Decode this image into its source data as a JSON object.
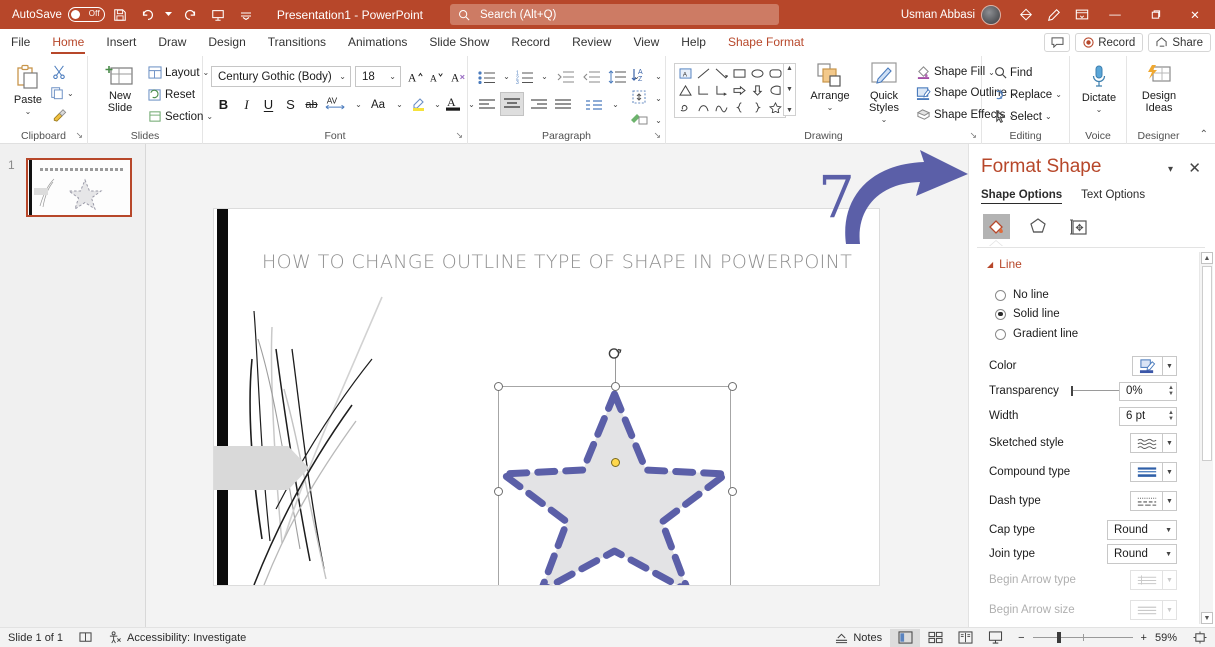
{
  "titlebar": {
    "autosave_label": "AutoSave",
    "autosave_state": "Off",
    "save_icon": "save-icon",
    "undo_icon": "undo-icon",
    "redo_icon": "redo-icon",
    "present_icon": "start-presentation-icon",
    "customize_icon": "customize-quick-access-icon",
    "document_title": "Presentation1  -  PowerPoint",
    "user_name": "Usman Abbasi",
    "search_placeholder": "Search (Alt+Q)",
    "diamond_icon": "microsoft-365-diamond-icon",
    "pen_icon": "pen-icon",
    "ribbon_display_icon": "ribbon-display-options-icon",
    "minimize_label": "—",
    "restore_label": "❐",
    "close_label": "✕"
  },
  "tabs": [
    {
      "label": "File",
      "active": false
    },
    {
      "label": "Home",
      "active": true
    },
    {
      "label": "Insert",
      "active": false
    },
    {
      "label": "Draw",
      "active": false
    },
    {
      "label": "Design",
      "active": false
    },
    {
      "label": "Transitions",
      "active": false
    },
    {
      "label": "Animations",
      "active": false
    },
    {
      "label": "Slide Show",
      "active": false
    },
    {
      "label": "Record",
      "active": false
    },
    {
      "label": "Review",
      "active": false
    },
    {
      "label": "View",
      "active": false
    },
    {
      "label": "Help",
      "active": false
    },
    {
      "label": "Shape Format",
      "active": false,
      "contextual": true
    }
  ],
  "tabbar_right": {
    "comments_icon": "comments-icon",
    "record_label": "Record",
    "share_label": "Share"
  },
  "ribbon": {
    "clipboard": {
      "group_label": "Clipboard",
      "paste_label": "Paste",
      "cut_icon": "scissors-icon",
      "copy_icon": "copy-icon",
      "format_painter_icon": "format-painter-icon",
      "dialog_launcher": "↘"
    },
    "slides": {
      "group_label": "Slides",
      "new_slide_label": "New\nSlide",
      "layout_label": "Layout",
      "reset_label": "Reset",
      "section_label": "Section"
    },
    "font": {
      "group_label": "Font",
      "font_family": "Century Gothic (Body)",
      "font_size": "18",
      "grow_font_icon": "grow-font-icon",
      "shrink_font_icon": "shrink-font-icon",
      "clear_formatting_icon": "clear-formatting-icon",
      "bold": "B",
      "italic": "I",
      "underline": "U",
      "shadow": "S",
      "strikethrough": "ab",
      "character_spacing": "AV",
      "change_case": "Aa",
      "highlight_icon": "text-highlight-icon",
      "font_color_icon": "font-color-icon",
      "dialog_launcher": "↘"
    },
    "paragraph": {
      "group_label": "Paragraph",
      "bullets_icon": "bullets-icon",
      "numbering_icon": "numbering-icon",
      "decrease_indent_icon": "decrease-indent-icon",
      "increase_indent_icon": "increase-indent-icon",
      "line_spacing_icon": "line-spacing-icon",
      "text_direction_icon": "text-direction-icon",
      "align_text_icon": "align-text-icon",
      "smartart_icon": "convert-to-smartart-icon",
      "align_left_icon": "align-left-icon",
      "align_center_icon": "align-center-icon",
      "align_right_icon": "align-right-icon",
      "justify_icon": "justify-icon",
      "columns_icon": "columns-icon",
      "dialog_launcher": "↘"
    },
    "drawing": {
      "group_label": "Drawing",
      "arrange_label": "Arrange",
      "quick_styles_label": "Quick\nStyles",
      "shape_fill_label": "Shape Fill",
      "shape_outline_label": "Shape Outline",
      "shape_effects_label": "Shape Effects",
      "dialog_launcher": "↘"
    },
    "editing": {
      "group_label": "Editing",
      "find_label": "Find",
      "replace_label": "Replace",
      "select_label": "Select"
    },
    "voice": {
      "group_label": "Voice",
      "dictate_label": "Dictate"
    },
    "designer": {
      "group_label": "Designer",
      "design_ideas_label": "Design\nIdeas"
    },
    "collapse_icon": "collapse-ribbon-icon"
  },
  "slides_panel": {
    "slide_number": "1"
  },
  "slide": {
    "title": "HOW TO CHANGE OUTLINE  TYPE OF SHAPE IN POWERPOINT",
    "shape": {
      "name": "5-point-star",
      "fill_color": "#e3e3e5",
      "outline_color": "#5b5fa8",
      "outline_style": "dashed",
      "selected": true
    },
    "annotation": {
      "arrow_color": "#5b5fa8",
      "number": "7"
    }
  },
  "format_shape": {
    "title": "Format Shape",
    "tab_shape_options": "Shape Options",
    "tab_text_options": "Text Options",
    "icon_fill_line": "fill-and-line-icon",
    "icon_effects": "effects-icon",
    "icon_size_properties": "size-and-properties-icon",
    "section_line": "Line",
    "options": [
      {
        "label": "No line",
        "selected": false
      },
      {
        "label": "Solid line",
        "selected": true
      },
      {
        "label": "Gradient line",
        "selected": false
      }
    ],
    "fields": [
      {
        "label": "Color",
        "control": "color-picker",
        "value": "",
        "disabled": false
      },
      {
        "label": "Transparency",
        "control": "slider-spinner",
        "value": "0%",
        "disabled": false
      },
      {
        "label": "Width",
        "control": "spinner",
        "value": "6 pt",
        "disabled": false
      },
      {
        "label": "Sketched style",
        "control": "gallery-picker",
        "value": "",
        "disabled": false
      },
      {
        "label": "Compound type",
        "control": "gallery-picker",
        "value": "",
        "disabled": false
      },
      {
        "label": "Dash type",
        "control": "gallery-picker",
        "value": "",
        "disabled": false
      },
      {
        "label": "Cap type",
        "control": "combo",
        "value": "Round",
        "disabled": false
      },
      {
        "label": "Join type",
        "control": "combo",
        "value": "Round",
        "disabled": false
      },
      {
        "label": "Begin Arrow type",
        "control": "gallery-picker",
        "value": "",
        "disabled": true
      },
      {
        "label": "Begin Arrow size",
        "control": "gallery-picker",
        "value": "",
        "disabled": true
      }
    ],
    "close_label": "✕",
    "menu_caret": "▾"
  },
  "statusbar": {
    "slide_count": "Slide 1 of 1",
    "language_icon": "proofing-icon",
    "accessibility": "Accessibility: Investigate",
    "notes_label": "Notes",
    "view_normal_icon": "normal-view-icon",
    "view_sorter_icon": "slide-sorter-icon",
    "view_reading_icon": "reading-view-icon",
    "view_slideshow_icon": "slideshow-view-icon",
    "zoom_out": "−",
    "zoom_in": "+",
    "zoom_level": "59%",
    "fit_icon": "fit-slide-to-window-icon"
  }
}
